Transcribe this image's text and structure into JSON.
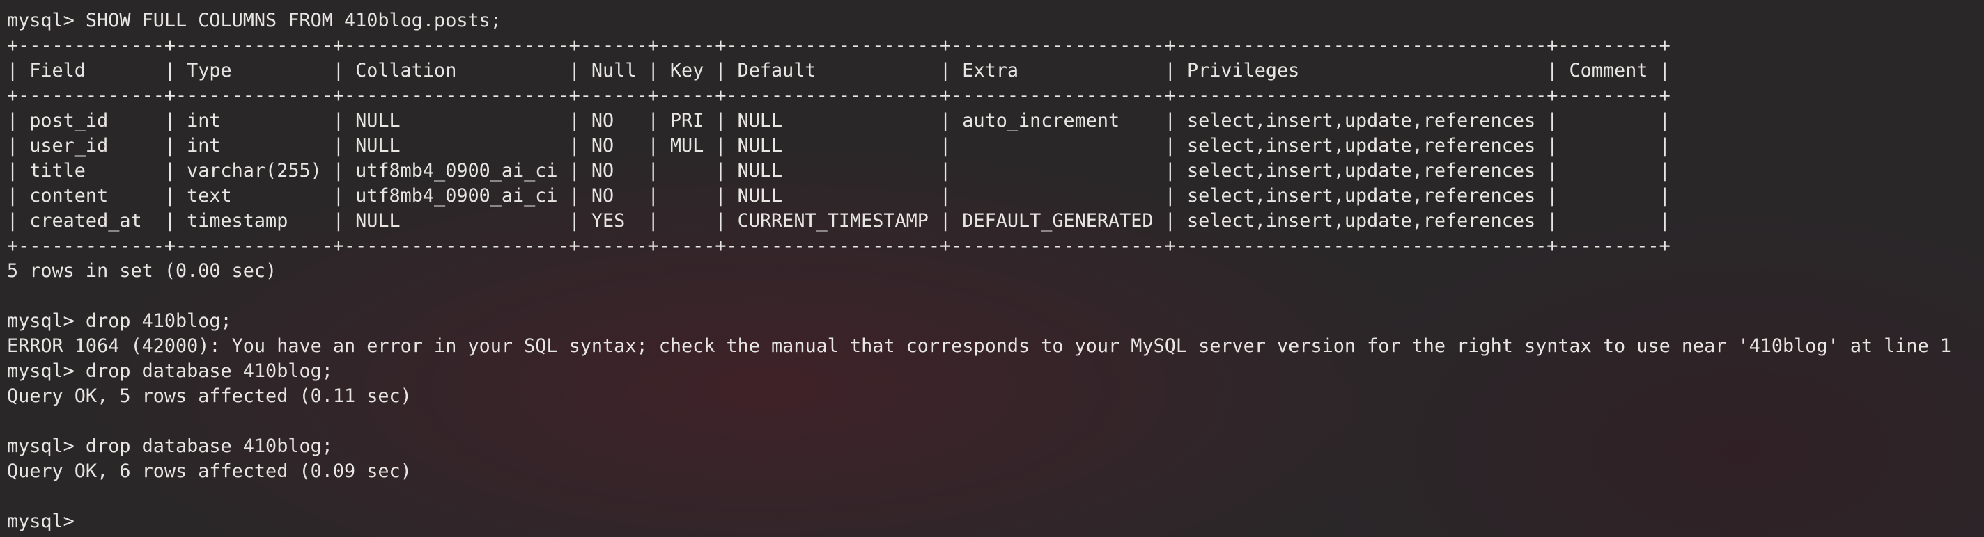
{
  "terminal": {
    "prompt": "mysql>",
    "lines": [
      "mysql> SHOW FULL COLUMNS FROM 410blog.posts;",
      "+-------------+--------------+--------------------+------+-----+-------------------+-------------------+---------------------------------+---------+",
      "| Field       | Type         | Collation          | Null | Key | Default           | Extra             | Privileges                      | Comment |",
      "+-------------+--------------+--------------------+------+-----+-------------------+-------------------+---------------------------------+---------+",
      "| post_id     | int          | NULL               | NO   | PRI | NULL              | auto_increment    | select,insert,update,references |         |",
      "| user_id     | int          | NULL               | NO   | MUL | NULL              |                   | select,insert,update,references |         |",
      "| title       | varchar(255) | utf8mb4_0900_ai_ci | NO   |     | NULL              |                   | select,insert,update,references |         |",
      "| content     | text         | utf8mb4_0900_ai_ci | NO   |     | NULL              |                   | select,insert,update,references |         |",
      "| created_at  | timestamp    | NULL               | YES  |     | CURRENT_TIMESTAMP | DEFAULT_GENERATED | select,insert,update,references |         |",
      "+-------------+--------------+--------------------+------+-----+-------------------+-------------------+---------------------------------+---------+",
      "5 rows in set (0.00 sec)",
      "",
      "mysql> drop 410blog;",
      "ERROR 1064 (42000): You have an error in your SQL syntax; check the manual that corresponds to your MySQL server version for the right syntax to use near '410blog' at line 1",
      "mysql> drop database 410blog;",
      "Query OK, 5 rows affected (0.11 sec)",
      "",
      "mysql> drop database 410blog;",
      "Query OK, 6 rows affected (0.09 sec)",
      "",
      "mysql> "
    ]
  },
  "colors": {
    "background": "#2a2729",
    "text": "#e8e6e3"
  }
}
